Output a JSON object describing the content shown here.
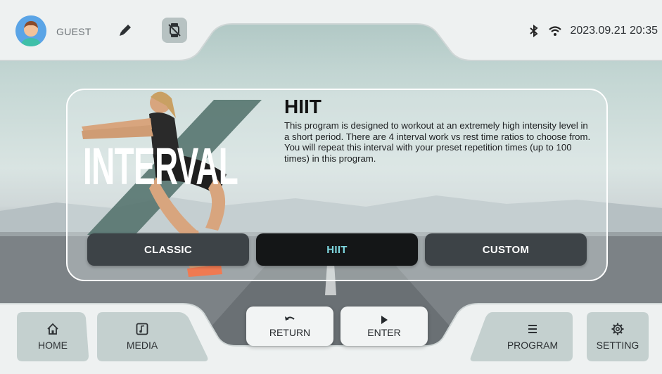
{
  "topbar": {
    "user_label": "GUEST",
    "datetime": "2023.09.21 20:35",
    "icons": [
      "avatar",
      "edit-icon",
      "watch-disconnected-icon",
      "bluetooth-icon",
      "wifi-icon"
    ]
  },
  "program": {
    "banner_word": "INTERVAL",
    "title": "HIIT",
    "description": "This program is designed to workout at an extremely high intensity level in a short period. There are 4 interval work vs rest time ratios to choose from. You will repeat this interval with your preset repetition times (up to 100 times) in this program.",
    "modes": [
      {
        "label": "CLASSIC",
        "active": false
      },
      {
        "label": "HIIT",
        "active": true
      },
      {
        "label": "CUSTOM",
        "active": false
      }
    ]
  },
  "controls": {
    "return_label": "RETURN",
    "enter_label": "ENTER"
  },
  "nav": {
    "home_label": "HOME",
    "media_label": "MEDIA",
    "program_label": "PROGRAM",
    "setting_label": "SETTING"
  },
  "colors": {
    "active_mode_text": "#7fd8e0",
    "mode_button": "#3d4347",
    "active_mode_button": "#141617"
  }
}
